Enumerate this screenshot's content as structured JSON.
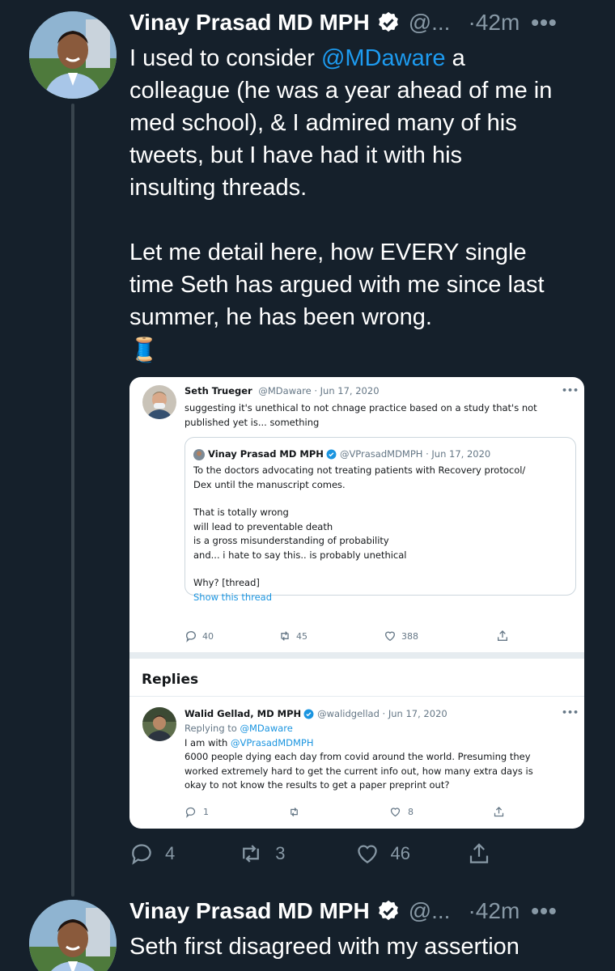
{
  "tweet1": {
    "name": "Vinay Prasad MD MPH",
    "handle": "@...",
    "time": "·42m",
    "more": "•••",
    "text": {
      "l1a": "I used to consider ",
      "mention": "@MDaware",
      "l1b": " a",
      "l2": "colleague (he was a year ahead of me in",
      "l3": "med school), & I admired many of his",
      "l4": "tweets, but I have had it with his",
      "l5": "insulting threads.",
      "l6": "Let me detail here, how EVERY single",
      "l7": "time Seth has argued with me since last",
      "l8": "summer, he has been wrong.",
      "emoji": "🧵"
    },
    "counts": {
      "replies": "4",
      "retweets": "3",
      "likes": "46"
    }
  },
  "embed": {
    "tweet": {
      "name": "Seth Trueger",
      "handle_date": "@MDaware · Jun 17, 2020",
      "line1": "suggesting it's unethical to not chnage practice based on a study that's not",
      "line2": "published yet is... something",
      "more": "•••"
    },
    "quote": {
      "name": "Vinay Prasad MD MPH",
      "handle_date": "@VPrasadMDMPH · Jun 17, 2020",
      "line1": "To the doctors advocating not treating patients with Recovery protocol/",
      "line2": "Dex until the manuscript comes.",
      "line3": "That is totally wrong",
      "line4": "will lead to preventable death",
      "line5": "is a gross misunderstanding of probability",
      "line6": "and... i hate to say this.. is probably unethical",
      "line7": "Why? [thread]",
      "show_thread": "Show this thread"
    },
    "counts": {
      "replies": "40",
      "retweets": "45",
      "likes": "388"
    },
    "replies_title": "Replies",
    "reply": {
      "name": "Walid Gellad, MD MPH",
      "handle_date": "@walidgellad · Jun 17, 2020",
      "replying_prefix": "Replying to ",
      "replying_to": "@MDaware",
      "line1_prefix": "I am with ",
      "line1_mention": "@VPrasadMDMPH",
      "line2": "6000 people dying each day from covid around the world. Presuming they",
      "line3": "worked extremely hard to get the current info out, how many extra days is",
      "line4": "okay to not know the results to get a paper preprint out?",
      "counts": {
        "replies": "1",
        "retweets": "",
        "likes": "8"
      },
      "more": "•••"
    }
  },
  "tweet2": {
    "name": "Vinay Prasad MD MPH",
    "handle": "@...",
    "time": "·42m",
    "more": "•••",
    "text_l1": "Seth first disagreed with my assertion"
  },
  "colors": {
    "background": "#15202b",
    "link": "#1d9bf0",
    "muted": "#8899a6",
    "thread_line": "#38444d"
  },
  "icons": [
    "verified-badge-icon",
    "reply-icon",
    "retweet-icon",
    "like-icon",
    "share-icon",
    "more-icon",
    "thread-emoji"
  ]
}
